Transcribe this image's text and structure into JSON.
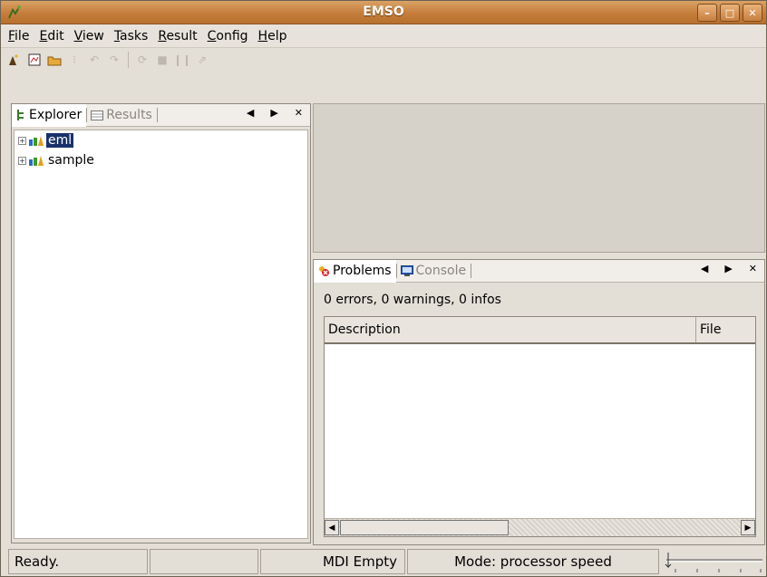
{
  "window": {
    "title": "EMSO"
  },
  "menu": [
    "File",
    "Edit",
    "View",
    "Tasks",
    "Result",
    "Config",
    "Help"
  ],
  "menu_accel": [
    "F",
    "E",
    "V",
    "T",
    "R",
    "C",
    "H"
  ],
  "toolbar": {
    "icons": [
      "new-project-icon",
      "new-file-icon",
      "open-folder-icon",
      "cut-icon",
      "undo-icon",
      "redo-icon",
      "run-icon",
      "stop-icon",
      "pause-icon",
      "resume-icon"
    ]
  },
  "explorer": {
    "tabs": [
      {
        "label": "Explorer",
        "active": true
      },
      {
        "label": "Results",
        "active": false
      }
    ],
    "tree": [
      {
        "label": "eml",
        "selected": true
      },
      {
        "label": "sample",
        "selected": false
      }
    ]
  },
  "problems": {
    "tabs": [
      {
        "label": "Problems",
        "active": true
      },
      {
        "label": "Console",
        "active": false
      }
    ],
    "summary": "0 errors, 0 warnings, 0 infos",
    "columns": [
      "Description",
      "File"
    ]
  },
  "status": {
    "message": "Ready.",
    "mdi": "MDI Empty",
    "mode": "Mode: processor speed"
  },
  "colors": {
    "titlebar": "#c57d3c",
    "selection": "#19316b"
  }
}
